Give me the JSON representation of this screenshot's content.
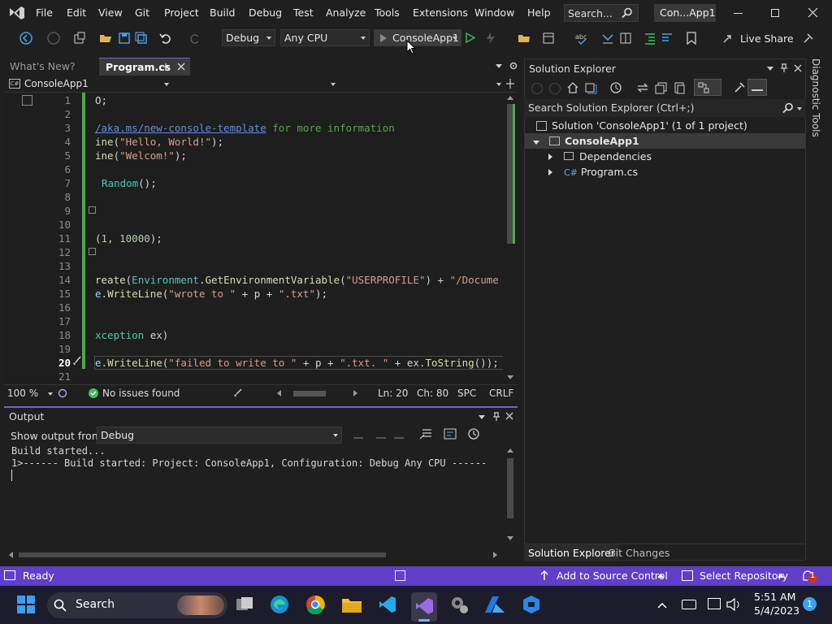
{
  "menu": [
    "File",
    "Edit",
    "View",
    "Git",
    "Project",
    "Build",
    "Debug",
    "Test",
    "Analyze",
    "Tools",
    "Extensions",
    "Window",
    "Help"
  ],
  "search": {
    "label": "Search..."
  },
  "solution_title": "Con...App1",
  "toolbar": {
    "config": "Debug",
    "platform": "Any CPU",
    "run_target": "ConsoleApp1",
    "live_share": "Live Share"
  },
  "tabs": {
    "whats_new": "What's New?",
    "program": "Program.cs"
  },
  "nav": {
    "project": "ConsoleApp1"
  },
  "editor": {
    "line_numbers": [
      "1",
      "2",
      "3",
      "4",
      "5",
      "6",
      "7",
      "8",
      "9",
      "10",
      "11",
      "12",
      "13",
      "14",
      "15",
      "16",
      "17",
      "18",
      "19",
      "20",
      "21"
    ],
    "code": {
      "l1": "O;",
      "l3_link": "/aka.ms/new-console-template",
      "l3_cmt": " for more information",
      "l4_fn": "ine",
      "l4_str": "\"Hello, World!\"",
      "l4_end": ");",
      "l5_fn": "ine",
      "l5_str": "\"Welcom!\"",
      "l5_end": ");",
      "l7_typ": "Random",
      "l7_end": "();",
      "l11_a": "(",
      "l11_n1": "1",
      "l11_b": ", ",
      "l11_n2": "10000",
      "l11_end": ");",
      "l14_fn": "reate",
      "l14_typ": "Environment",
      "l14_fn2": "GetEnvironmentVariable",
      "l14_str": "\"USERPROFILE\"",
      "l14_mid": ") + ",
      "l14_str2": "\"/Docume",
      "l15_var": "e",
      "l15_fn": "WriteLine",
      "l15_str": "\"wrote to \"",
      "l15_mid": " + p + ",
      "l15_str2": "\".txt\"",
      "l15_end": ");",
      "l18_typ": "xception",
      "l18_end": " ex)",
      "l20_var": "e",
      "l20_fn": "WriteLine",
      "l20_str": "\"failed to write to \"",
      "l20_mid": " + p + ",
      "l20_str2": "\".txt. \"",
      "l20_mid2": " + ex.",
      "l20_fn2": "ToString",
      "l20_end": "());"
    }
  },
  "editor_status": {
    "zoom": "100 %",
    "issues": "No issues found",
    "ln": "Ln: 20",
    "ch": "Ch: 80",
    "spc": "SPC",
    "crlf": "CRLF"
  },
  "output": {
    "title": "Output",
    "show_from_label": "Show output from:",
    "source": "Debug",
    "line1": "Build started...",
    "line2": "1>------ Build started: Project: ConsoleApp1, Configuration: Debug Any CPU ------"
  },
  "solution_explorer": {
    "title": "Solution Explorer",
    "search_placeholder": "Search Solution Explorer (Ctrl+;)",
    "solution": "Solution 'ConsoleApp1' (1 of 1 project)",
    "project": "ConsoleApp1",
    "dependencies": "Dependencies",
    "program": "Program.cs",
    "tab_solution": "Solution Explorer",
    "tab_git": "Git Changes"
  },
  "diagnostic_tools": "Diagnostic Tools",
  "statusbar": {
    "ready": "Ready",
    "add_source": "Add to Source Control",
    "select_repo": "Select Repository",
    "notif_count": "1"
  },
  "taskbar": {
    "search": "Search",
    "time": "5:51 AM",
    "date": "5/4/2023",
    "badge": "1"
  },
  "colors": {
    "accent": "#6040c8",
    "vs_purple": "#7160e8"
  }
}
